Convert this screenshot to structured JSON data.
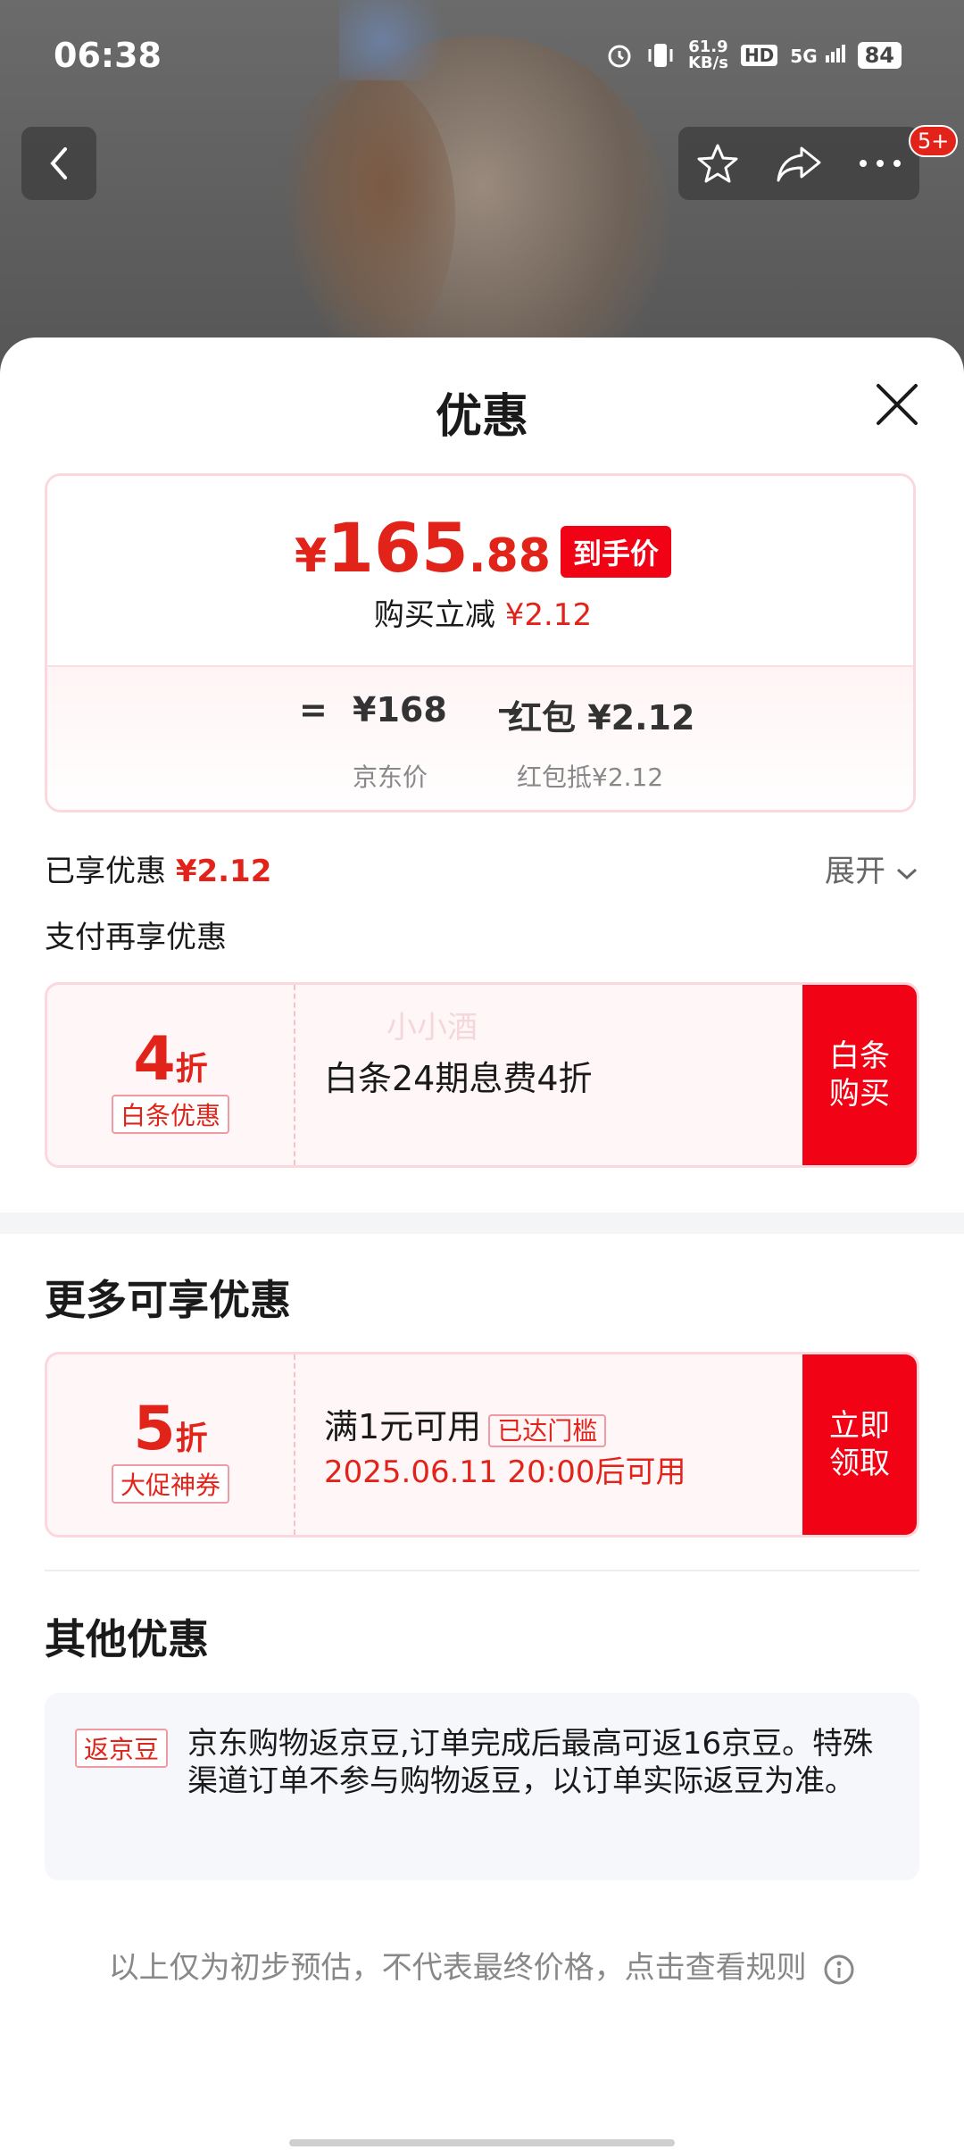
{
  "status": {
    "time": "06:38",
    "net_speed_top": "61.9",
    "net_speed_unit": "KB/s",
    "hd": "HD",
    "signal": "5G",
    "battery": "84"
  },
  "top_nav": {
    "badge": "5+"
  },
  "sheet": {
    "title": "优惠"
  },
  "price": {
    "yen": "¥",
    "int": "165",
    "dec": ".88",
    "tag": "到手价",
    "reduce_label": "购买立减",
    "reduce_amount": "¥2.12",
    "eq": "=",
    "jd_price": "¥168",
    "minus": "−",
    "redpack": "红包 ¥2.12",
    "jd_price_label": "京东价",
    "redpack_label": "红包抵¥2.12"
  },
  "enjoyed": {
    "label": "已享优惠",
    "amount": "¥2.12",
    "expand": "展开"
  },
  "pay_more": "支付再享优惠",
  "coupon_baitiao": {
    "num": "4",
    "unit": "折",
    "tag": "白条优惠",
    "watermark": "小小酒",
    "text": "白条24期息费4折",
    "button": "白条\n购买"
  },
  "more_title": "更多可享优惠",
  "coupon_promo": {
    "num": "5",
    "unit": "折",
    "tag": "大促神券",
    "line1": "满1元可用",
    "reached": "已达门槛",
    "line2": "2025.06.11 20:00后可用",
    "button": "立即\n领取"
  },
  "other_title": "其他优惠",
  "bean": {
    "tag": "返京豆",
    "text": "京东购物返京豆,订单完成后最高可返16京豆。特殊渠道订单不参与购物返豆，以订单实际返豆为准。"
  },
  "footer_note": "以上仅为初步预估，不代表最终价格，点击查看规则"
}
